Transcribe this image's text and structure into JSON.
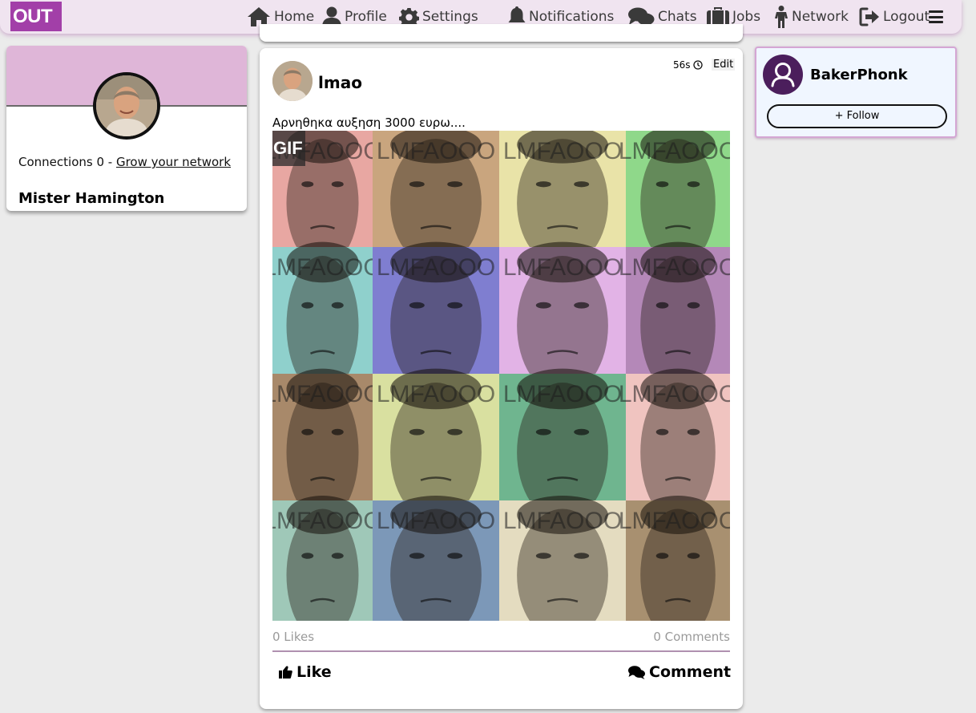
{
  "brand": {
    "logo_text": "OUT",
    "accent": "#a23fa8"
  },
  "nav": {
    "items": [
      {
        "label": "Home",
        "icon": "home-icon"
      },
      {
        "label": "Profile",
        "icon": "user-icon"
      },
      {
        "label": "Settings",
        "icon": "gear-icon"
      },
      {
        "label": "Notifications",
        "icon": "bell-icon"
      },
      {
        "label": "Chats",
        "icon": "chat-icon"
      },
      {
        "label": "Jobs",
        "icon": "briefcase-icon"
      },
      {
        "label": "Network",
        "icon": "person-icon"
      },
      {
        "label": "Logout",
        "icon": "logout-icon"
      }
    ],
    "menu_icon": "hamburger-icon"
  },
  "profile": {
    "connections_prefix": "Connections 0 - ",
    "grow_link": "Grow your network",
    "name": "Mister Hamington"
  },
  "post": {
    "author": "lmao",
    "time": "56s",
    "edit_label": "Edit",
    "text": "Αρνηθηκα αυξηση 3000 ευρω....",
    "gif_badge": "GIF",
    "gif_caption": "LMFAOOO",
    "likes": "0 Likes",
    "comments": "0 Comments",
    "like_label": "Like",
    "comment_label": "Comment"
  },
  "suggestion": {
    "name": "BakerPhonk",
    "follow_label": "+ Follow"
  },
  "colors": {
    "navbar_bg": "#f0e4f0",
    "banner": "#dfb6d8",
    "suggest_bg": "#f0f6ff",
    "suggest_avatar": "#4b1e5c"
  }
}
